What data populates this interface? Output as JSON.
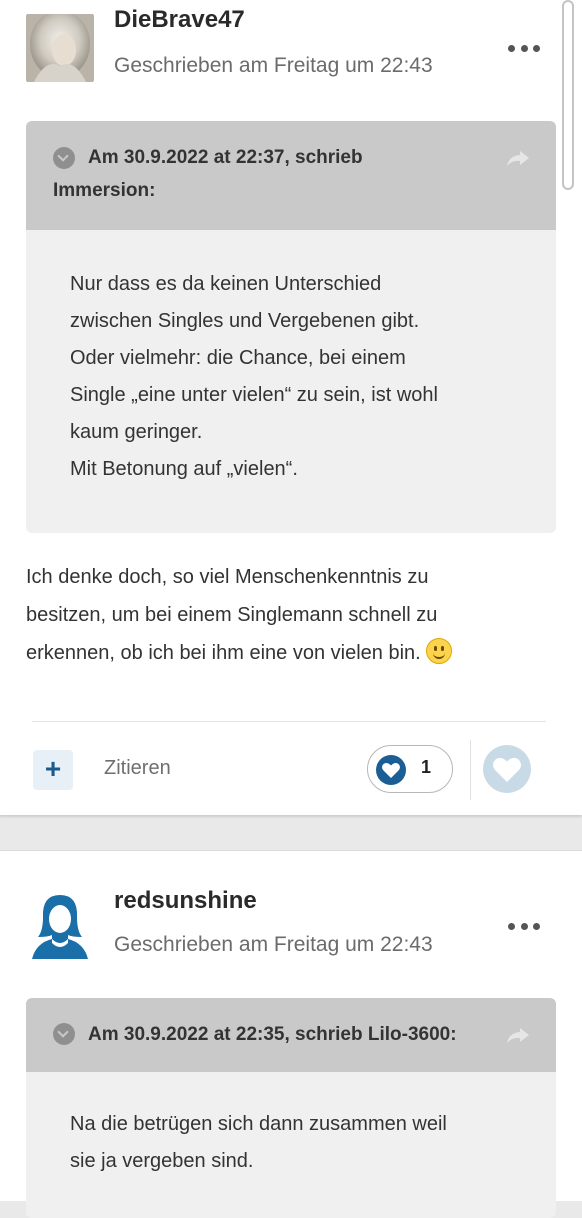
{
  "posts": [
    {
      "author": "DieBrave47",
      "date": "Geschrieben am Freitag um 22:43",
      "quote": {
        "title_line1": "Am 30.9.2022 at 22:37, schrieb",
        "title_line2": "Immersion:",
        "lines": [
          "Nur dass es da keinen Unterschied",
          "zwischen Singles und Vergebenen gibt.",
          "Oder vielmehr: die Chance, bei einem",
          "Single „eine unter vielen“ zu sein, ist wohl",
          "kaum geringer.",
          "Mit Betonung auf „vielen“."
        ]
      },
      "body_lines": [
        "Ich denke doch, so viel Menschenkenntnis zu",
        "besitzen, um bei einem Singlemann schnell zu",
        "erkennen, ob ich bei ihm eine von vielen bin."
      ],
      "actions": {
        "plus_label": "+",
        "quote_label": "Zitieren",
        "like_count": "1"
      }
    },
    {
      "author": "redsunshine",
      "date": "Geschrieben am Freitag um 22:43",
      "quote": {
        "title_line1": "Am 30.9.2022 at 22:35, schrieb Lilo-3600:",
        "lines": [
          "Na die betrügen sich dann zusammen weil",
          "sie ja vergeben sind."
        ]
      }
    }
  ],
  "colors": {
    "accent": "#1b5e95",
    "quote_header_bg": "#c9c9c9",
    "quote_body_bg": "#f0f0f0"
  },
  "icons": [
    "more-options-icon",
    "chevron-down-icon",
    "share-icon",
    "plus-icon",
    "heart-icon",
    "smiley-icon",
    "user-avatar-icon"
  ]
}
